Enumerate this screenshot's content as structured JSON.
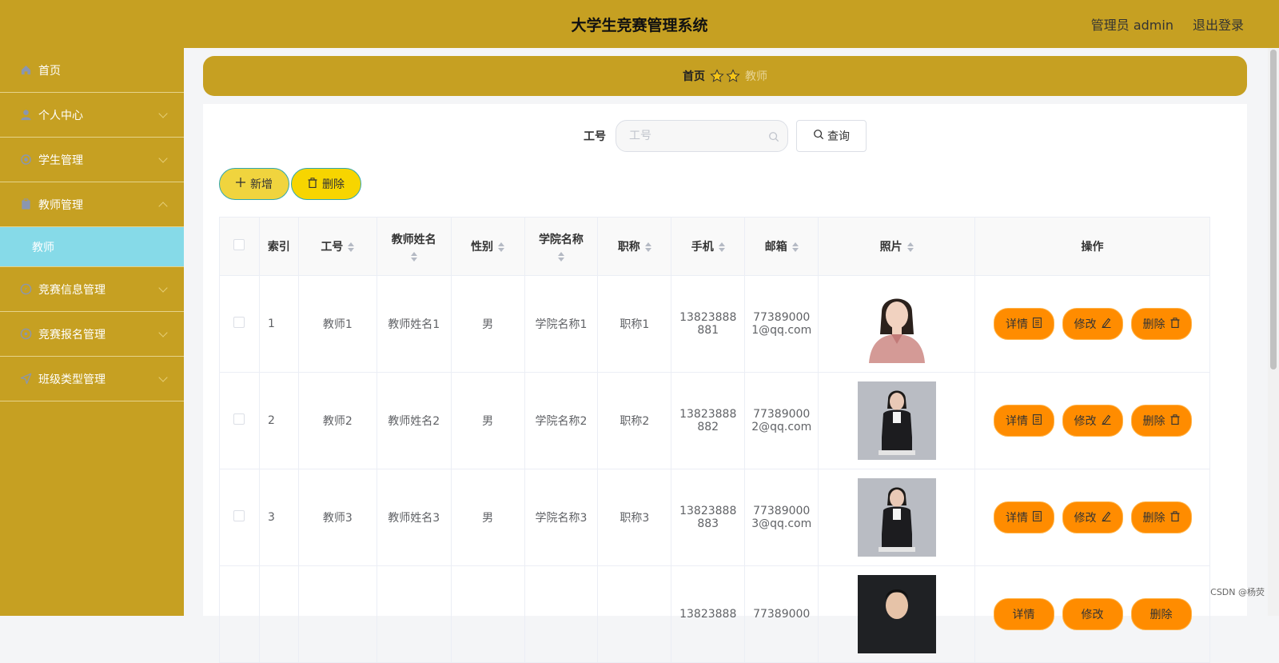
{
  "header": {
    "title": "大学生竞赛管理系统",
    "user": "管理员 admin",
    "logout": "退出登录"
  },
  "sidebar": {
    "items": [
      {
        "label": "首页",
        "icon": "home-icon"
      },
      {
        "label": "个人中心",
        "icon": "user-icon"
      },
      {
        "label": "学生管理",
        "icon": "settings-icon"
      },
      {
        "label": "教师管理",
        "icon": "clipboard-icon"
      },
      {
        "label": "竞赛信息管理",
        "icon": "compass-icon"
      },
      {
        "label": "竞赛报名管理",
        "icon": "circle-icon"
      },
      {
        "label": "班级类型管理",
        "icon": "send-icon"
      }
    ],
    "submenu": {
      "label": "教师"
    }
  },
  "breadcrumb": {
    "home": "首页",
    "current": "教师"
  },
  "search": {
    "label": "工号",
    "placeholder": "工号",
    "query_label": "查询"
  },
  "actions": {
    "add": "新增",
    "delete": "删除"
  },
  "table": {
    "headers": {
      "index": "索引",
      "job_no": "工号",
      "teacher_name": "教师姓名",
      "gender": "性别",
      "college": "学院名称",
      "title": "职称",
      "phone": "手机",
      "email": "邮箱",
      "photo": "照片",
      "ops": "操作"
    },
    "rows": [
      {
        "index": "1",
        "job_no": "教师1",
        "teacher_name": "教师姓名1",
        "gender": "男",
        "college": "学院名称1",
        "title": "职称1",
        "phone_1": "13823888",
        "phone_2": "881",
        "email_1": "77389000",
        "email_2": "1@qq.com"
      },
      {
        "index": "2",
        "job_no": "教师2",
        "teacher_name": "教师姓名2",
        "gender": "男",
        "college": "学院名称2",
        "title": "职称2",
        "phone_1": "13823888",
        "phone_2": "882",
        "email_1": "77389000",
        "email_2": "2@qq.com"
      },
      {
        "index": "3",
        "job_no": "教师3",
        "teacher_name": "教师姓名3",
        "gender": "男",
        "college": "学院名称3",
        "title": "职称3",
        "phone_1": "13823888",
        "phone_2": "883",
        "email_1": "77389000",
        "email_2": "3@qq.com"
      },
      {
        "index": "",
        "job_no": "",
        "teacher_name": "",
        "gender": "",
        "college": "",
        "title": "",
        "phone_1": "13823888",
        "phone_2": "",
        "email_1": "77389000",
        "email_2": ""
      }
    ],
    "op_labels": {
      "detail": "详情",
      "edit": "修改",
      "delete": "删除"
    }
  },
  "watermark": "CSDN @杨荧",
  "colors": {
    "brand": "#c6a022",
    "active_submenu": "#86dae8",
    "op_button": "#ff8c00"
  }
}
